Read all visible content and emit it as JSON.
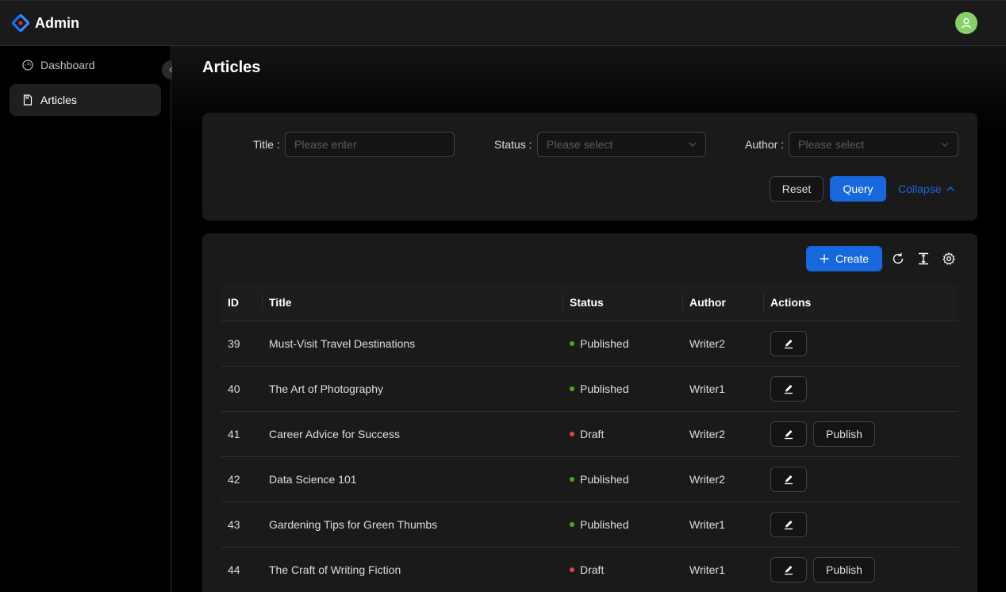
{
  "header": {
    "app_title": "Admin",
    "logo_icon": "diamond-logo-icon",
    "avatar_icon": "user-icon"
  },
  "sidebar": {
    "items": [
      {
        "label": "Dashboard",
        "icon": "dashboard-icon",
        "active": false
      },
      {
        "label": "Articles",
        "icon": "file-icon",
        "active": true
      }
    ]
  },
  "page": {
    "title": "Articles"
  },
  "filters": {
    "title_label": "Title",
    "title_placeholder": "Please enter",
    "status_label": "Status",
    "status_placeholder": "Please select",
    "author_label": "Author",
    "author_placeholder": "Please select",
    "reset_label": "Reset",
    "query_label": "Query",
    "collapse_label": "Collapse"
  },
  "toolbar": {
    "create_label": "Create"
  },
  "table": {
    "columns": [
      "ID",
      "Title",
      "Status",
      "Author",
      "Actions"
    ],
    "rows": [
      {
        "id": "39",
        "title": "Must-Visit Travel Destinations",
        "status": "Published",
        "author": "Writer2",
        "publish": ""
      },
      {
        "id": "40",
        "title": "The Art of Photography",
        "status": "Published",
        "author": "Writer1",
        "publish": ""
      },
      {
        "id": "41",
        "title": "Career Advice for Success",
        "status": "Draft",
        "author": "Writer2",
        "publish": "Publish"
      },
      {
        "id": "42",
        "title": "Data Science 101",
        "status": "Published",
        "author": "Writer2",
        "publish": ""
      },
      {
        "id": "43",
        "title": "Gardening Tips for Green Thumbs",
        "status": "Published",
        "author": "Writer1",
        "publish": ""
      },
      {
        "id": "44",
        "title": "The Craft of Writing Fiction",
        "status": "Draft",
        "author": "Writer1",
        "publish": "Publish"
      }
    ]
  },
  "colors": {
    "primary": "#1668dc",
    "published": "#49aa19",
    "draft": "#dc4446",
    "avatar": "#87d068"
  }
}
